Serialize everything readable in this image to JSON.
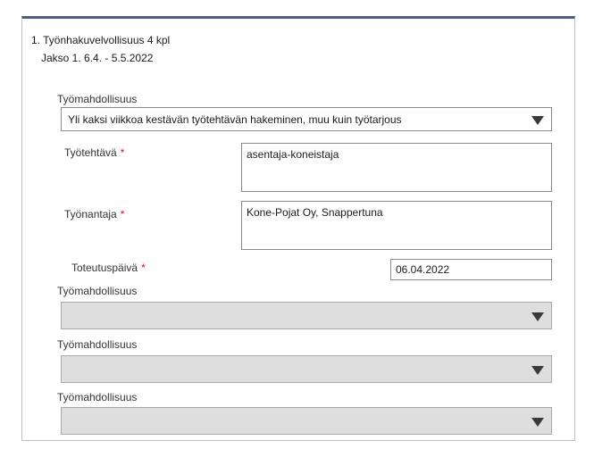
{
  "header": {
    "title": "1. Työnhakuvelvollisuus 4 kpl",
    "period": "Jakso 1. 6.4. - 5.5.2022"
  },
  "first_entry": {
    "opportunity_label": "Työmahdollisuus",
    "opportunity_value": "Yli kaksi viikkoa kestävän työtehtävän hakeminen, muu kuin työtarjous",
    "task_label": "Työtehtävä",
    "task_value": "asentaja-koneistaja",
    "employer_label": "Työnantaja",
    "employer_value": "Kone-Pojat Oy, Snappertuna",
    "date_label": "Toteutuspäivä",
    "date_value": "06.04.2022",
    "required_marker": "*"
  },
  "other_entries": [
    {
      "label": "Työmahdollisuus",
      "value": ""
    },
    {
      "label": "Työmahdollisuus",
      "value": ""
    },
    {
      "label": "Työmahdollisuus",
      "value": ""
    }
  ],
  "icons": {
    "dropdown": "triangle-down-icon"
  },
  "colors": {
    "required": "#d0142c",
    "panel_top_border": "#4f5f80",
    "disabled_field": "#dedede"
  }
}
